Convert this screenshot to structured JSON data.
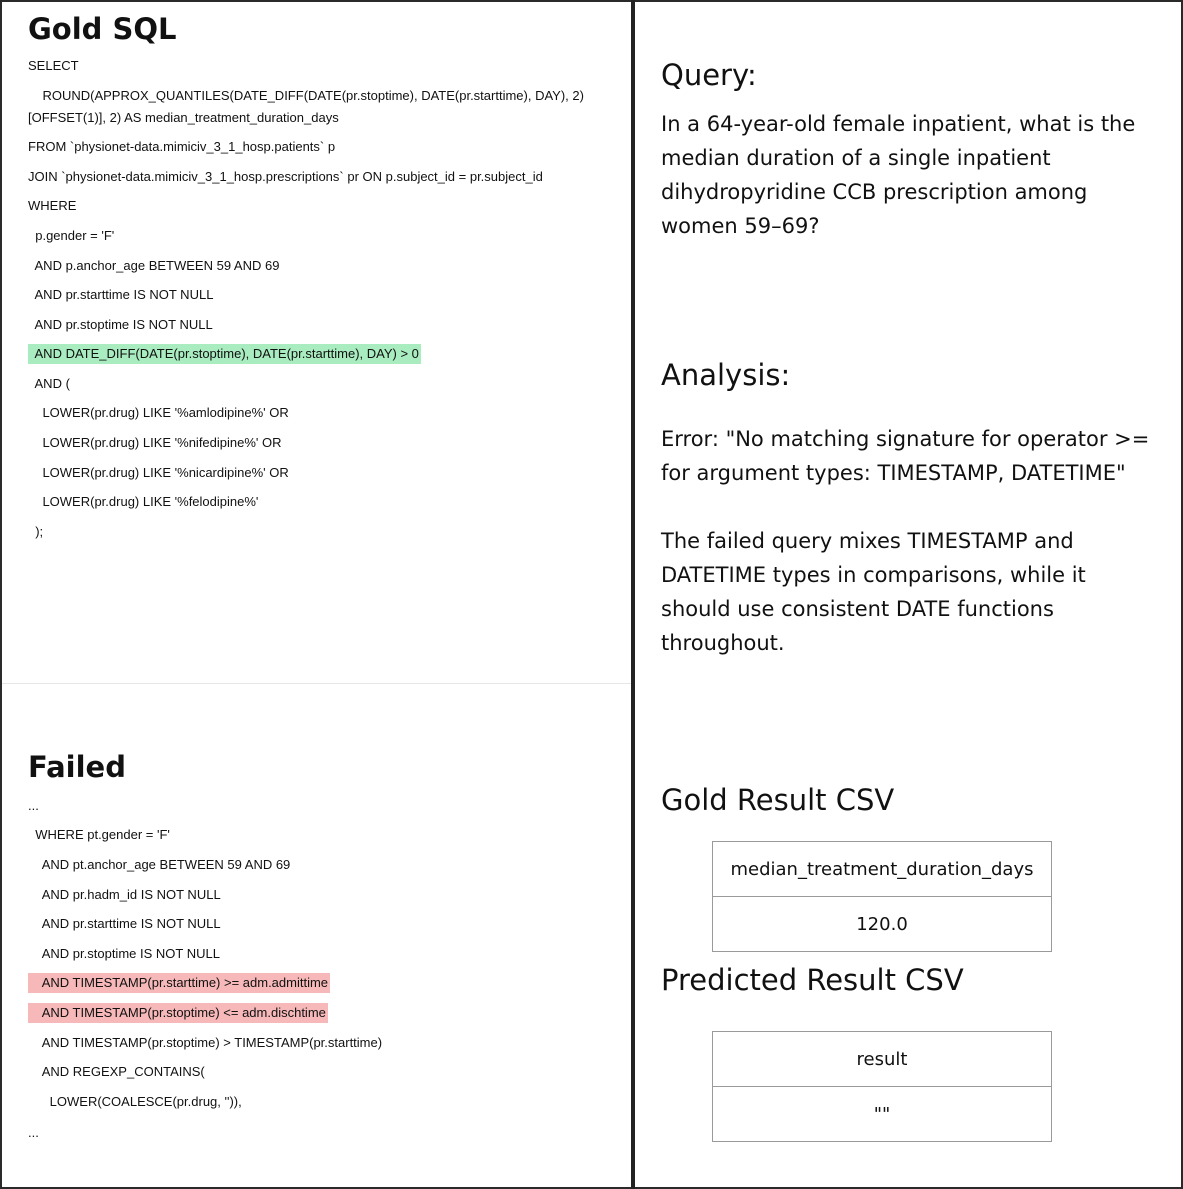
{
  "gold": {
    "title": "Gold SQL",
    "lines": [
      "SELECT",
      "    ROUND(APPROX_QUANTILES(DATE_DIFF(DATE(pr.stoptime), DATE(pr.starttime), DAY), 2)[OFFSET(1)], 2) AS median_treatment_duration_days",
      "FROM `physionet-data.mimiciv_3_1_hosp.patients` p",
      "JOIN `physionet-data.mimiciv_3_1_hosp.prescriptions` pr ON p.subject_id = pr.subject_id",
      "WHERE",
      "  p.gender = 'F'",
      "  AND p.anchor_age BETWEEN 59 AND 69",
      "  AND pr.starttime IS NOT NULL",
      "  AND pr.stoptime IS NOT NULL",
      "  AND DATE_DIFF(DATE(pr.stoptime), DATE(pr.starttime), DAY) > 0",
      "  AND (",
      "    LOWER(pr.drug) LIKE '%amlodipine%' OR",
      "    LOWER(pr.drug) LIKE '%nifedipine%' OR",
      "    LOWER(pr.drug) LIKE '%nicardipine%' OR",
      "    LOWER(pr.drug) LIKE '%felodipine%'",
      "  );"
    ]
  },
  "failed": {
    "title": "Failed",
    "lines": [
      "...",
      "  WHERE pt.gender = 'F'",
      "    AND pt.anchor_age BETWEEN 59 AND 69",
      "    AND pr.hadm_id IS NOT NULL",
      "    AND pr.starttime IS NOT NULL",
      "    AND pr.stoptime IS NOT NULL",
      "    AND TIMESTAMP(pr.starttime) >= adm.admittime",
      "    AND TIMESTAMP(pr.stoptime) <= adm.dischtime",
      "    AND TIMESTAMP(pr.stoptime) > TIMESTAMP(pr.starttime)",
      "    AND REGEXP_CONTAINS(",
      "      LOWER(COALESCE(pr.drug, '')),",
      "..."
    ]
  },
  "query": {
    "heading": "Query:",
    "text": "In a 64-year-old female inpatient, what is the median duration of a single inpatient dihydropyridine CCB prescription among women 59–69?"
  },
  "analysis": {
    "heading": "Analysis:",
    "error": "Error: \"No matching signature for operator >= for argument types: TIMESTAMP, DATETIME\"",
    "explanation": "The failed query mixes TIMESTAMP and DATETIME types in comparisons, while it should use consistent DATE functions throughout."
  },
  "gold_result": {
    "heading": "Gold Result CSV",
    "header": "median_treatment_duration_days",
    "value": "120.0"
  },
  "predicted_result": {
    "heading": "Predicted Result CSV",
    "header": "result",
    "value": "\"\""
  },
  "colors": {
    "highlight_correct": "#a8ecc0",
    "highlight_error": "#f6b8b8"
  }
}
